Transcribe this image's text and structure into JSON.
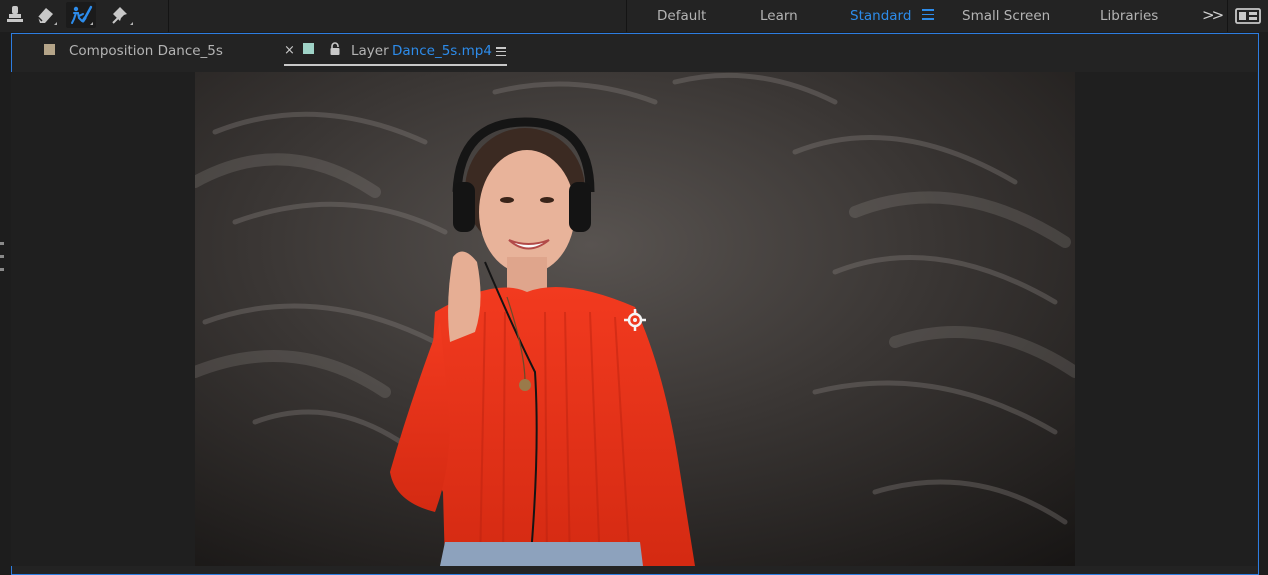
{
  "toolbar": {
    "tools": [
      {
        "name": "clone-stamp-tool",
        "active": false
      },
      {
        "name": "eraser-tool",
        "active": false
      },
      {
        "name": "roto-brush-tool",
        "active": true
      },
      {
        "name": "puppet-pin-tool",
        "active": false
      }
    ],
    "workspaces": [
      "Default",
      "Learn",
      "Standard",
      "Small Screen",
      "Libraries"
    ],
    "active_workspace": "Standard",
    "overflow_icon": ">>",
    "accent_color": "#2d8ceb"
  },
  "panel": {
    "composition_tab": {
      "label": "Composition Dance_5s",
      "swatch_color": "#b5a589"
    },
    "layer_tab": {
      "close": "×",
      "swatch_color": "#9fd3c7",
      "prefix": "Layer",
      "name": "Dance_5s.mp4",
      "name_color": "#2d8ceb"
    }
  },
  "viewer": {
    "content": "video-frame-woman-headphones-red-sweater",
    "anchor_point_icon": "anchor-point-icon"
  }
}
